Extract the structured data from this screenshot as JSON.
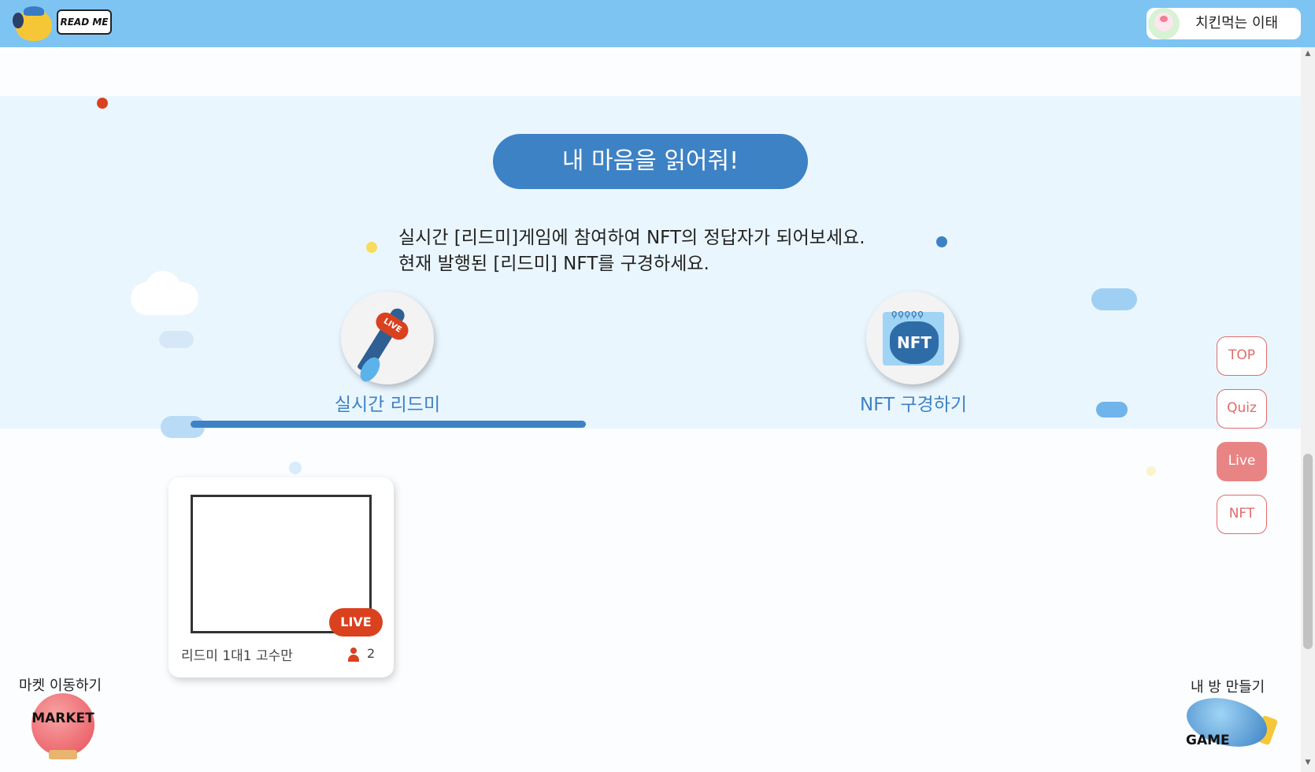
{
  "header": {
    "logo_text": "READ ME",
    "profile": {
      "name": "치킨먹는 이태",
      "avatar_icon": "pig-avatar-icon"
    }
  },
  "section": {
    "title_button": "내 마음을 읽어줘!",
    "description_line1": "실시간 [리드미]게임에 참여하여 NFT의 정답자가 되어보세요.",
    "description_line2": "현재 발행된 [리드미] NFT를 구경하세요."
  },
  "tabs": [
    {
      "label": "실시간 리드미",
      "icon": "live-brush-icon",
      "icon_badge": "LIVE",
      "active": true
    },
    {
      "label": "NFT 구경하기",
      "icon": "nft-cat-icon",
      "icon_badge": "NFT",
      "active": false
    }
  ],
  "side_nav": [
    {
      "label": "TOP",
      "active": false
    },
    {
      "label": "Quiz",
      "active": false
    },
    {
      "label": "Live",
      "active": true
    },
    {
      "label": "NFT",
      "active": false
    }
  ],
  "live_rooms": [
    {
      "badge": "LIVE",
      "title": "리드미 1대1 고수만",
      "participants": "2"
    }
  ],
  "bottom": {
    "market_label": "마켓 이동하기",
    "market_balloon_text": "MARKET",
    "room_label": "내 방 만들기",
    "game_text": "GAME"
  },
  "colors": {
    "header_bg": "#7ec4f3",
    "primary_blue": "#3d82c4",
    "band_bg": "#eaf6fe",
    "live_red": "#d9411f",
    "nav_pink": "#e06b6b",
    "nav_active_bg": "#e98485"
  }
}
